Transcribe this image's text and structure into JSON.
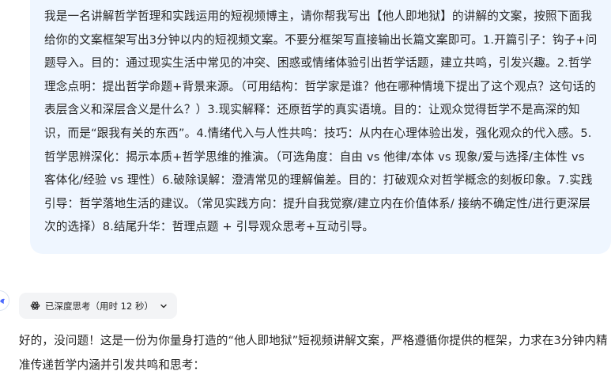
{
  "user_message": {
    "text": "我是一名讲解哲学哲理和实践运用的短视频博主，请你帮我写出【他人即地狱】的讲解的文案，按照下面我给你的文案框架写出3分钟以内的短视频文案。不要分框架写直接输出长篇文案即可。1.开篇引子：钩子+问题导入。目的：通过现实生活中常见的冲突、困惑或情绪体验引出哲学话题，建立共鸣，引发兴趣。2.哲学理念点明：提出哲学命题+背景来源。（可用结构：哲学家是谁？他在哪种情境下提出了这个观点？这句话的表层含义和深层含义是什么？）3.现实解释：还原哲学的真实语境。目的：让观众觉得哲学不是高深的知识，而是“跟我有关的东西”。4.情绪代入与人性共鸣：技巧：从内在心理体验出发，强化观众的代入感。5.哲学思辨深化：揭示本质+哲学思维的推演。（可选角度：自由 vs 他律/本体 vs 现象/爱与选择/主体性 vs 客体化/经验 vs 理性）6.破除误解：澄清常见的理解偏差。目的：打破观众对哲学概念的刻板印象。7.实践引导：哲学落地生活的建议。（常见实践方向：提升自我觉察/建立内在价值体系/ 接纳不确定性/进行更深层次的选择）8.结尾升华：哲理点题 + 引导观众思考+互动引导。"
  },
  "thinking": {
    "label": "已深度思考（用时 12 秒）",
    "icon": "atom-icon",
    "toggle_icon": "chevron-down-icon"
  },
  "assistant_reply": {
    "text": "好的，没问题！这是一份为你量身打造的“他人即地狱”短视频讲解文案，严格遵循你提供的框架，力求在3分钟内精准传递哲学内涵并引发共鸣和思考："
  },
  "colors": {
    "user_bubble_bg": "#eff6ff",
    "chip_bg": "#f3f4f6",
    "text": "#262626",
    "avatar_accent": "#4d6bfe"
  }
}
